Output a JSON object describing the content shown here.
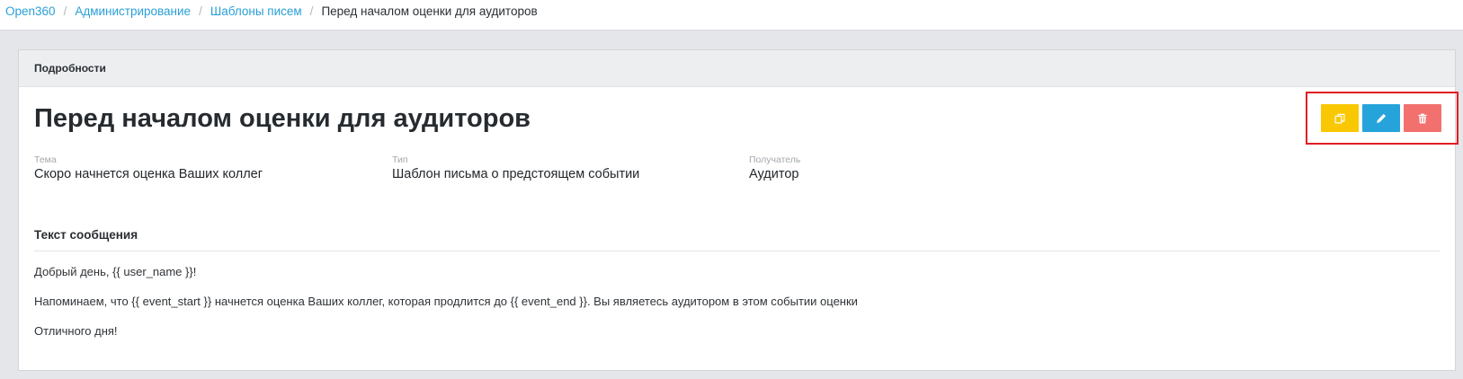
{
  "breadcrumb": {
    "separator": "/",
    "items": [
      {
        "label": "Open360"
      },
      {
        "label": "Администрирование"
      },
      {
        "label": "Шаблоны писем"
      },
      {
        "label": "Перед началом оценки для аудиторов"
      }
    ]
  },
  "card": {
    "header_title": "Подробности"
  },
  "template": {
    "title": "Перед началом оценки для аудиторов",
    "fields": [
      {
        "label": "Тема",
        "value": "Скоро начнется оценка Ваших коллег"
      },
      {
        "label": "Тип",
        "value": "Шаблон письма о предстоящем событии"
      },
      {
        "label": "Получатель",
        "value": "Аудитор"
      }
    ]
  },
  "actions": {
    "buttons": [
      {
        "icon": "copy-icon",
        "color": "#f9c802"
      },
      {
        "icon": "pencil-icon",
        "color": "#27a3db"
      },
      {
        "icon": "trash-icon",
        "color": "#f2716f"
      }
    ]
  },
  "message": {
    "heading": "Текст сообщения",
    "lines": [
      "Добрый день, {{ user_name }}!",
      "Напоминаем, что {{ event_start }} начнется оценка Ваших коллег, которая продлится до {{ event_end }}. Вы являетесь аудитором в этом событии оценки",
      "Отличного дня!"
    ]
  },
  "theme": {
    "link_color": "#2a9fd6",
    "highlight_color": "#e21d24",
    "page_background": "#e4e6e9"
  }
}
